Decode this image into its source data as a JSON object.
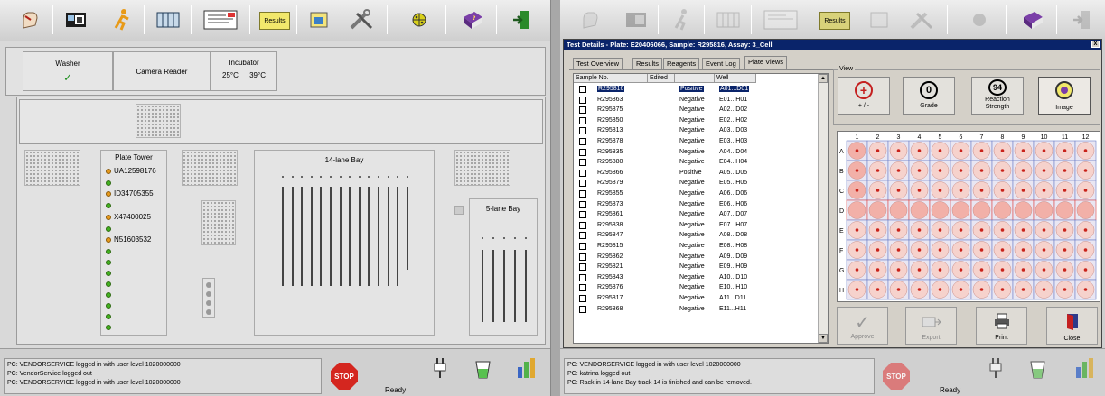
{
  "left": {
    "toolbar": {
      "results_label": "Results"
    },
    "modules": [
      {
        "name": "Washer",
        "status": "✓"
      },
      {
        "name": "Camera Reader"
      },
      {
        "name": "Incubator",
        "temp1": "25°C",
        "temp2": "39°C"
      }
    ],
    "plate_tower": {
      "title": "Plate Tower",
      "plates": [
        "UA12598176",
        "ID34705355",
        "X47400025",
        "N51603532"
      ]
    },
    "bay14_title": "14-lane Bay",
    "bay5_title": "5-lane Bay",
    "log": [
      "PC: VENDORSERVICE logged in with user level 1020000000",
      "PC: VendorService logged out",
      "PC: VENDORSERVICE logged in with user level 1020000000"
    ],
    "stop_label": "STOP",
    "status": "Ready"
  },
  "right": {
    "toolbar": {
      "results_label": "Results"
    },
    "dialog": {
      "title": "Test Details - Plate: E20406066, Sample: R295816, Assay: 3_Cell",
      "close": "x",
      "tabs": [
        "Test Overview",
        "Results",
        "Reagents",
        "Event Log",
        "Plate Views"
      ],
      "columns": [
        "Sample No.",
        "Edited",
        "",
        "Well"
      ],
      "rows": [
        {
          "sample": "R295816",
          "result": "Positive",
          "well": "A01...D01"
        },
        {
          "sample": "R295863",
          "result": "Negative",
          "well": "E01...H01"
        },
        {
          "sample": "R295875",
          "result": "Negative",
          "well": "A02...D02"
        },
        {
          "sample": "R295850",
          "result": "Negative",
          "well": "E02...H02"
        },
        {
          "sample": "R295813",
          "result": "Negative",
          "well": "A03...D03"
        },
        {
          "sample": "R295878",
          "result": "Negative",
          "well": "E03...H03"
        },
        {
          "sample": "R295835",
          "result": "Negative",
          "well": "A04...D04"
        },
        {
          "sample": "R295880",
          "result": "Negative",
          "well": "E04...H04"
        },
        {
          "sample": "R295866",
          "result": "Positive",
          "well": "A05...D05"
        },
        {
          "sample": "R295879",
          "result": "Negative",
          "well": "E05...H05"
        },
        {
          "sample": "R295855",
          "result": "Negative",
          "well": "A06...D06"
        },
        {
          "sample": "R295873",
          "result": "Negative",
          "well": "E06...H06"
        },
        {
          "sample": "R295861",
          "result": "Negative",
          "well": "A07...D07"
        },
        {
          "sample": "R295838",
          "result": "Negative",
          "well": "E07...H07"
        },
        {
          "sample": "R295847",
          "result": "Negative",
          "well": "A08...D08"
        },
        {
          "sample": "R295815",
          "result": "Negative",
          "well": "E08...H08"
        },
        {
          "sample": "R295862",
          "result": "Negative",
          "well": "A09...D09"
        },
        {
          "sample": "R295821",
          "result": "Negative",
          "well": "E09...H09"
        },
        {
          "sample": "R295843",
          "result": "Negative",
          "well": "A10...D10"
        },
        {
          "sample": "R295876",
          "result": "Negative",
          "well": "E10...H10"
        },
        {
          "sample": "R295817",
          "result": "Negative",
          "well": "A11...D11"
        },
        {
          "sample": "R295868",
          "result": "Negative",
          "well": "E11...H11"
        }
      ],
      "view": {
        "group_label": "View",
        "buttons": [
          {
            "glyph": "+",
            "label": "+ / -"
          },
          {
            "glyph": "0",
            "label": "Grade"
          },
          {
            "glyph": "94",
            "label": "Reaction Strength"
          },
          {
            "glyph": "",
            "label": "Image"
          }
        ]
      },
      "plate": {
        "cols": [
          "1",
          "2",
          "3",
          "4",
          "5",
          "6",
          "7",
          "8",
          "9",
          "10",
          "11",
          "12"
        ],
        "rows": [
          "A",
          "B",
          "C",
          "D",
          "E",
          "F",
          "G",
          "H"
        ]
      },
      "actions": [
        "Approve",
        "Export",
        "Print",
        "Close"
      ]
    },
    "log": [
      "PC: VENDORSERVICE logged in with user level 1020000000",
      "PC: katrina logged out",
      "PC: Rack in 14-lane Bay track 14 is finished and can be removed."
    ],
    "stop_label": "STOP",
    "status": "Ready"
  }
}
